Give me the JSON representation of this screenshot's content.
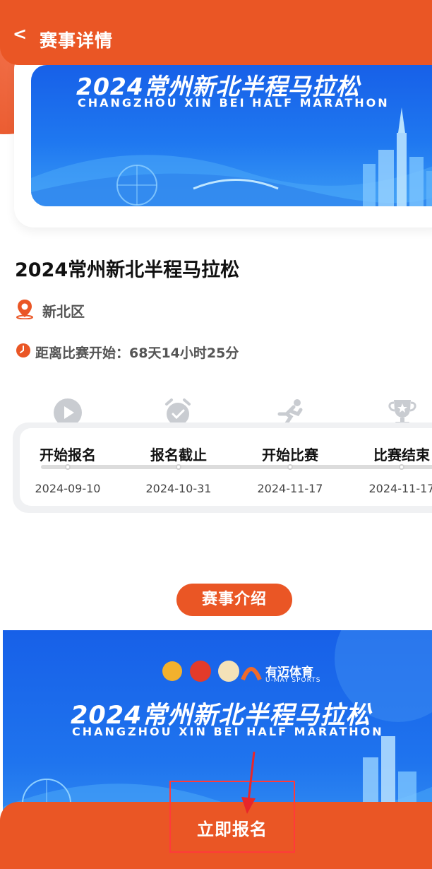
{
  "header": {
    "back_glyph": "<",
    "title": "赛事详情"
  },
  "banner": {
    "title": "2024常州新北半程马拉松",
    "subtitle": "CHANGZHOU XIN BEI HALF MARATHON"
  },
  "event": {
    "title": "2024常州新北半程马拉松",
    "location": "新北区",
    "countdown": "距离比赛开始：68天14小时25分"
  },
  "timeline": {
    "steps": [
      {
        "label": "开始报名",
        "date": "2024-09-10",
        "icon": "play-icon"
      },
      {
        "label": "报名截止",
        "date": "2024-10-31",
        "icon": "alarm-clock-icon"
      },
      {
        "label": "开始比赛",
        "date": "2024-11-17",
        "icon": "runner-icon"
      },
      {
        "label": "比赛结束",
        "date": "2024-11-17",
        "icon": "trophy-icon"
      }
    ]
  },
  "intro": {
    "label": "赛事介绍",
    "poster_title": "2024常州新北半程马拉松",
    "poster_subtitle": "CHANGZHOU XIN BEI HALF MARATHON",
    "sponsor_name": "有迈体育",
    "sponsor_sub": "U-MAY SPORTS"
  },
  "footer": {
    "signup_label": "立即报名"
  },
  "colors": {
    "accent": "#ea5625",
    "banner_blue": "#1f74ee",
    "highlight_box": "#ff3a3a"
  }
}
